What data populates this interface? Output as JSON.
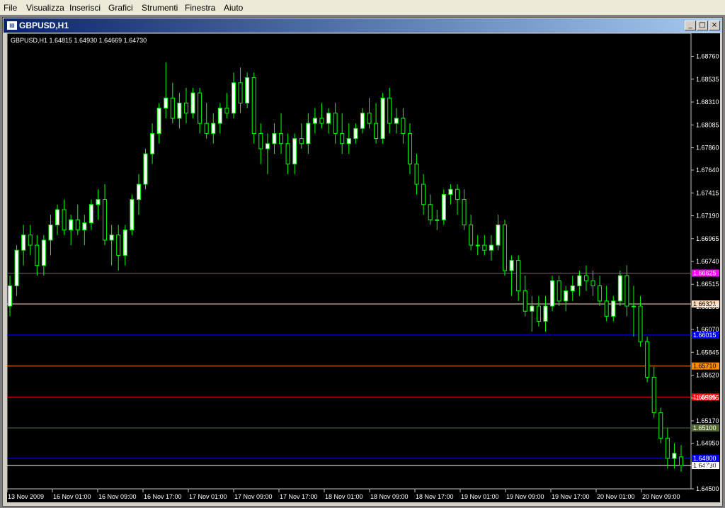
{
  "menu": {
    "items": [
      {
        "label": "File",
        "name": "menu-file"
      },
      {
        "label": "Visualizza",
        "name": "menu-visualizza"
      },
      {
        "label": "Inserisci",
        "name": "menu-inserisci"
      },
      {
        "label": "Grafici",
        "name": "menu-grafici"
      },
      {
        "label": "Strumenti",
        "name": "menu-strumenti"
      },
      {
        "label": "Finestra",
        "name": "menu-finestra"
      },
      {
        "label": "Aiuto",
        "name": "menu-aiuto"
      }
    ]
  },
  "window": {
    "title": "GBPUSD,H1",
    "minimize_icon": "minimize-icon",
    "maximize_icon": "maximize-icon",
    "close_icon": "close-icon"
  },
  "chart_header": "GBPUSD,H1  1.64815 1.64930 1.64669 1.64730",
  "colors": {
    "background": "#000000",
    "bull_candle": "#ffffff",
    "wick": "#00ff00",
    "text": "#ffffff"
  },
  "chart_data": {
    "type": "candlestick",
    "symbol": "GBPUSD",
    "timeframe": "H1",
    "ylim": [
      1.645,
      1.6898
    ],
    "y_ticks": [
      "1.68760",
      "1.68535",
      "1.68310",
      "1.68085",
      "1.67860",
      "1.67640",
      "1.67415",
      "1.67190",
      "1.66965",
      "1.66740",
      "1.66515",
      "1.66295",
      "1.66070",
      "1.65845",
      "1.65620",
      "1.65395",
      "1.65170",
      "1.64950",
      "1.64730",
      "1.64500"
    ],
    "x_labels": [
      "13 Nov 2009",
      "16 Nov 01:00",
      "16 Nov 09:00",
      "16 Nov 17:00",
      "17 Nov 01:00",
      "17 Nov 09:00",
      "17 Nov 17:00",
      "18 Nov 01:00",
      "18 Nov 09:00",
      "18 Nov 17:00",
      "19 Nov 01:00",
      "19 Nov 09:00",
      "19 Nov 17:00",
      "20 Nov 01:00",
      "20 Nov 09:00"
    ],
    "levels": [
      {
        "value": 1.66625,
        "label": "1.66625",
        "color": "#ff00ff"
      },
      {
        "value": 1.66321,
        "label": "1.66321",
        "color": "#ffdab9"
      },
      {
        "value": 1.66015,
        "label": "1.66015",
        "color": "#0000ff"
      },
      {
        "value": 1.6571,
        "label": "1.65710",
        "color": "#ff8c00"
      },
      {
        "value": 1.65405,
        "label": "1.65405",
        "color": "#ff0000"
      },
      {
        "value": 1.651,
        "label": "1.65100",
        "color": "#556b2f"
      },
      {
        "value": 1.648,
        "label": "1.64800",
        "color": "#0000ff"
      },
      {
        "value": 1.6473,
        "label": "1.64730",
        "color": "#ffffff"
      }
    ],
    "candles": [
      [
        1.663,
        1.666,
        1.662,
        1.665
      ],
      [
        1.665,
        1.669,
        1.664,
        1.6685
      ],
      [
        1.6685,
        1.671,
        1.667,
        1.67
      ],
      [
        1.67,
        1.671,
        1.668,
        1.669
      ],
      [
        1.669,
        1.67,
        1.666,
        1.667
      ],
      [
        1.667,
        1.67,
        1.666,
        1.6695
      ],
      [
        1.6695,
        1.672,
        1.668,
        1.671
      ],
      [
        1.671,
        1.673,
        1.67,
        1.6725
      ],
      [
        1.6725,
        1.6735,
        1.67,
        1.6705
      ],
      [
        1.6705,
        1.672,
        1.669,
        1.6715
      ],
      [
        1.6715,
        1.673,
        1.67,
        1.6705
      ],
      [
        1.6705,
        1.672,
        1.669,
        1.6712
      ],
      [
        1.6712,
        1.6735,
        1.6705,
        1.673
      ],
      [
        1.673,
        1.6745,
        1.6715,
        1.6735
      ],
      [
        1.6735,
        1.675,
        1.669,
        1.6695
      ],
      [
        1.6695,
        1.671,
        1.667,
        1.67
      ],
      [
        1.67,
        1.671,
        1.6665,
        1.668
      ],
      [
        1.668,
        1.671,
        1.667,
        1.6705
      ],
      [
        1.6705,
        1.674,
        1.67,
        1.6735
      ],
      [
        1.6735,
        1.676,
        1.672,
        1.675
      ],
      [
        1.675,
        1.6785,
        1.6745,
        1.678
      ],
      [
        1.678,
        1.681,
        1.677,
        1.68
      ],
      [
        1.68,
        1.683,
        1.679,
        1.6825
      ],
      [
        1.6825,
        1.687,
        1.6815,
        1.6835
      ],
      [
        1.6835,
        1.685,
        1.681,
        1.6815
      ],
      [
        1.6815,
        1.684,
        1.6805,
        1.683
      ],
      [
        1.683,
        1.6845,
        1.681,
        1.682
      ],
      [
        1.682,
        1.6845,
        1.6815,
        1.684
      ],
      [
        1.684,
        1.6845,
        1.68,
        1.681
      ],
      [
        1.681,
        1.683,
        1.6795,
        1.68
      ],
      [
        1.68,
        1.682,
        1.679,
        1.681
      ],
      [
        1.681,
        1.683,
        1.68,
        1.6825
      ],
      [
        1.6825,
        1.684,
        1.6815,
        1.682
      ],
      [
        1.682,
        1.686,
        1.6815,
        1.685
      ],
      [
        1.685,
        1.6865,
        1.682,
        1.683
      ],
      [
        1.683,
        1.686,
        1.6825,
        1.6855
      ],
      [
        1.6855,
        1.686,
        1.679,
        1.68
      ],
      [
        1.68,
        1.681,
        1.677,
        1.6785
      ],
      [
        1.6785,
        1.68,
        1.676,
        1.679
      ],
      [
        1.679,
        1.681,
        1.678,
        1.68
      ],
      [
        1.68,
        1.682,
        1.678,
        1.679
      ],
      [
        1.679,
        1.68,
        1.676,
        1.677
      ],
      [
        1.677,
        1.68,
        1.676,
        1.6795
      ],
      [
        1.6795,
        1.681,
        1.6785,
        1.679
      ],
      [
        1.679,
        1.682,
        1.678,
        1.681
      ],
      [
        1.681,
        1.6825,
        1.68,
        1.6815
      ],
      [
        1.6815,
        1.683,
        1.6805,
        1.681
      ],
      [
        1.681,
        1.6825,
        1.68,
        1.682
      ],
      [
        1.682,
        1.683,
        1.679,
        1.68
      ],
      [
        1.68,
        1.682,
        1.678,
        1.679
      ],
      [
        1.679,
        1.681,
        1.678,
        1.6795
      ],
      [
        1.6795,
        1.681,
        1.679,
        1.6805
      ],
      [
        1.6805,
        1.6825,
        1.68,
        1.682
      ],
      [
        1.682,
        1.6835,
        1.6805,
        1.681
      ],
      [
        1.681,
        1.683,
        1.679,
        1.6795
      ],
      [
        1.6795,
        1.684,
        1.679,
        1.6835
      ],
      [
        1.6835,
        1.6845,
        1.68,
        1.681
      ],
      [
        1.681,
        1.6825,
        1.68,
        1.6815
      ],
      [
        1.6815,
        1.6825,
        1.679,
        1.68
      ],
      [
        1.68,
        1.681,
        1.676,
        1.677
      ],
      [
        1.677,
        1.678,
        1.674,
        1.675
      ],
      [
        1.675,
        1.676,
        1.672,
        1.673
      ],
      [
        1.673,
        1.674,
        1.671,
        1.6715
      ],
      [
        1.6715,
        1.6725,
        1.6705,
        1.6715
      ],
      [
        1.6715,
        1.6745,
        1.671,
        1.674
      ],
      [
        1.674,
        1.675,
        1.673,
        1.6745
      ],
      [
        1.6745,
        1.675,
        1.672,
        1.6735
      ],
      [
        1.6735,
        1.6745,
        1.6705,
        1.671
      ],
      [
        1.671,
        1.672,
        1.6685,
        1.669
      ],
      [
        1.669,
        1.67,
        1.668,
        1.669
      ],
      [
        1.669,
        1.67,
        1.668,
        1.6685
      ],
      [
        1.6685,
        1.67,
        1.6675,
        1.669
      ],
      [
        1.669,
        1.672,
        1.6685,
        1.671
      ],
      [
        1.671,
        1.6715,
        1.666,
        1.6665
      ],
      [
        1.6665,
        1.668,
        1.664,
        1.6675
      ],
      [
        1.6675,
        1.668,
        1.6635,
        1.6645
      ],
      [
        1.6645,
        1.666,
        1.662,
        1.6625
      ],
      [
        1.6625,
        1.664,
        1.6605,
        1.663
      ],
      [
        1.663,
        1.664,
        1.661,
        1.6615
      ],
      [
        1.6615,
        1.664,
        1.6605,
        1.663
      ],
      [
        1.663,
        1.666,
        1.6625,
        1.6655
      ],
      [
        1.6655,
        1.666,
        1.663,
        1.6635
      ],
      [
        1.6635,
        1.665,
        1.6625,
        1.6645
      ],
      [
        1.6645,
        1.666,
        1.6635,
        1.665
      ],
      [
        1.665,
        1.6665,
        1.664,
        1.666
      ],
      [
        1.666,
        1.667,
        1.6645,
        1.6655
      ],
      [
        1.6655,
        1.6665,
        1.664,
        1.665
      ],
      [
        1.665,
        1.666,
        1.663,
        1.6635
      ],
      [
        1.6635,
        1.665,
        1.6615,
        1.662
      ],
      [
        1.662,
        1.664,
        1.6615,
        1.6635
      ],
      [
        1.6635,
        1.6665,
        1.663,
        1.666
      ],
      [
        1.666,
        1.667,
        1.662,
        1.663
      ],
      [
        1.663,
        1.665,
        1.66,
        1.663
      ],
      [
        1.663,
        1.664,
        1.659,
        1.6595
      ],
      [
        1.6595,
        1.66,
        1.6555,
        1.656
      ],
      [
        1.656,
        1.657,
        1.652,
        1.6525
      ],
      [
        1.6525,
        1.653,
        1.6495,
        1.65
      ],
      [
        1.65,
        1.651,
        1.647,
        1.648
      ],
      [
        1.648,
        1.6495,
        1.647,
        1.6485
      ],
      [
        1.64815,
        1.6493,
        1.64669,
        1.6473
      ]
    ]
  }
}
